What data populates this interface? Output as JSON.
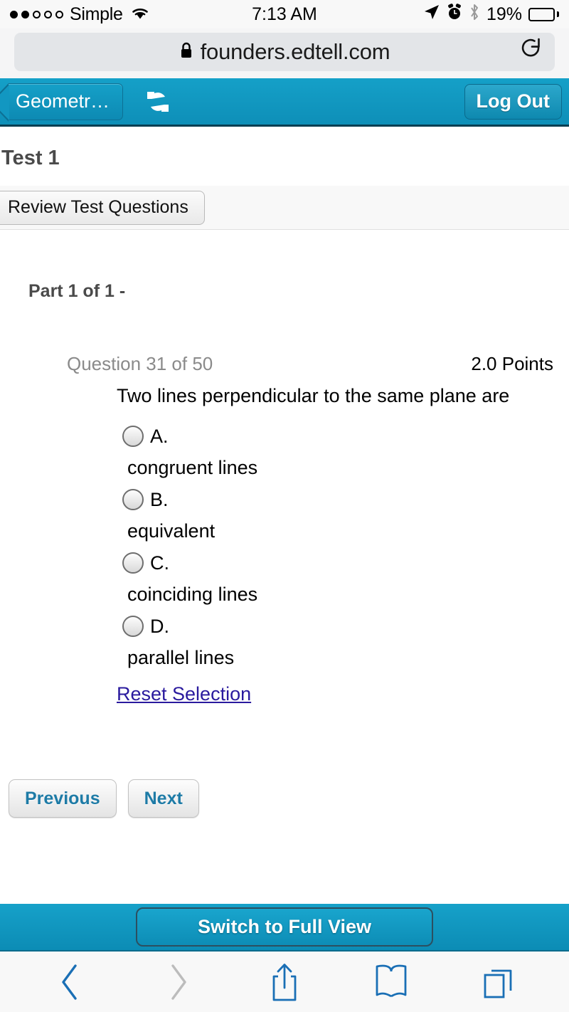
{
  "status_bar": {
    "carrier": "Simple",
    "signal_dots_filled": 2,
    "signal_dots_total": 5,
    "wifi_icon": "wifi-icon",
    "time": "7:13 AM",
    "location_icon": "location-arrow-icon",
    "alarm_icon": "alarm-clock-icon",
    "bluetooth_icon": "bluetooth-icon",
    "battery_percent": "19%",
    "battery_fill_ratio": 0.19,
    "battery_color": "#ffcc00"
  },
  "browser": {
    "lock_icon": "lock-icon",
    "url": "founders.edtell.com",
    "reload_icon": "reload-icon",
    "toolbar": {
      "back_icon": "chevron-left-icon",
      "forward_icon": "chevron-right-icon",
      "share_icon": "share-icon",
      "bookmarks_icon": "book-icon",
      "tabs_icon": "tabs-icon",
      "back_enabled": true,
      "forward_enabled": false,
      "active_color": "#1a6fb5",
      "disabled_color": "#b8b8b8"
    }
  },
  "app_nav": {
    "back_label": "Geometr…",
    "refresh_icon": "refresh-icon",
    "logout_label": "Log Out",
    "bar_color": "#0e8fb8"
  },
  "page": {
    "title": "Test 1",
    "review_button_label": "Review Test Questions",
    "part_label": "Part 1 of 1 -"
  },
  "question": {
    "number_label": "Question 31 of 50",
    "points_label": "2.0 Points",
    "text": "Two lines perpendicular to the same plane are",
    "choices": [
      {
        "letter": "A.",
        "text": "congruent lines",
        "selected": false
      },
      {
        "letter": "B.",
        "text": "equivalent",
        "selected": false
      },
      {
        "letter": "C.",
        "text": "coinciding lines",
        "selected": false
      },
      {
        "letter": "D.",
        "text": "parallel lines",
        "selected": false
      }
    ],
    "reset_link_label": "Reset Selection",
    "reset_link_color": "#2a1a9e"
  },
  "pagination": {
    "previous_label": "Previous",
    "next_label": "Next",
    "button_text_color": "#1e7ba6"
  },
  "footer": {
    "full_view_label": "Switch to Full View"
  }
}
